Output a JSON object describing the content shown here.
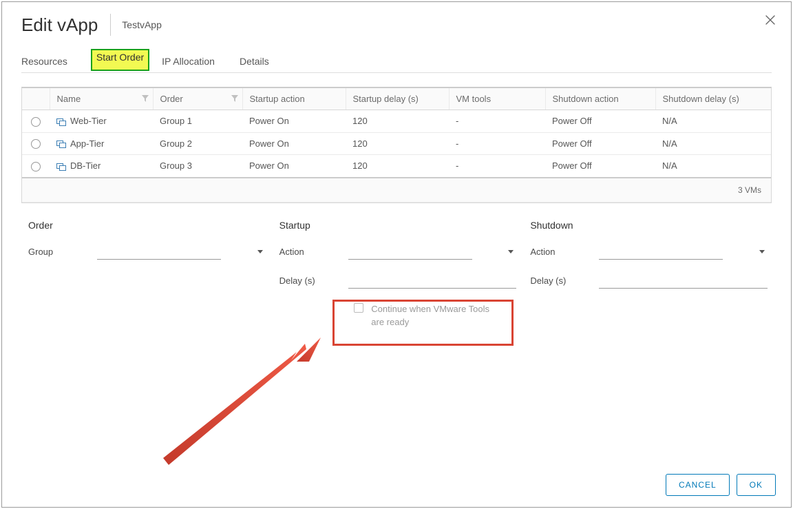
{
  "header": {
    "title": "Edit vApp",
    "subtitle": "TestvApp"
  },
  "tabs": [
    {
      "label": "Resources",
      "active": false
    },
    {
      "label": "Start Order",
      "active": true
    },
    {
      "label": "IP Allocation",
      "active": false
    },
    {
      "label": "Details",
      "active": false
    }
  ],
  "table": {
    "columns": [
      "",
      "Name",
      "Order",
      "Startup action",
      "Startup delay (s)",
      "VM tools",
      "Shutdown action",
      "Shutdown delay (s)"
    ],
    "rows": [
      {
        "name": "Web-Tier",
        "order": "Group 1",
        "startup_action": "Power On",
        "startup_delay": "120",
        "vm_tools": "-",
        "shutdown_action": "Power Off",
        "shutdown_delay": "N/A"
      },
      {
        "name": "App-Tier",
        "order": "Group 2",
        "startup_action": "Power On",
        "startup_delay": "120",
        "vm_tools": "-",
        "shutdown_action": "Power Off",
        "shutdown_delay": "N/A"
      },
      {
        "name": "DB-Tier",
        "order": "Group 3",
        "startup_action": "Power On",
        "startup_delay": "120",
        "vm_tools": "-",
        "shutdown_action": "Power Off",
        "shutdown_delay": "N/A"
      }
    ],
    "footer": "3 VMs"
  },
  "form": {
    "order": {
      "section": "Order",
      "group_label": "Group"
    },
    "startup": {
      "section": "Startup",
      "action_label": "Action",
      "delay_label": "Delay (s)",
      "checkbox_text": "Continue when VMware Tools are ready"
    },
    "shutdown": {
      "section": "Shutdown",
      "action_label": "Action",
      "delay_label": "Delay (s)"
    }
  },
  "buttons": {
    "cancel": "CANCEL",
    "ok": "OK"
  },
  "annotation": {
    "color": "#d94433"
  }
}
